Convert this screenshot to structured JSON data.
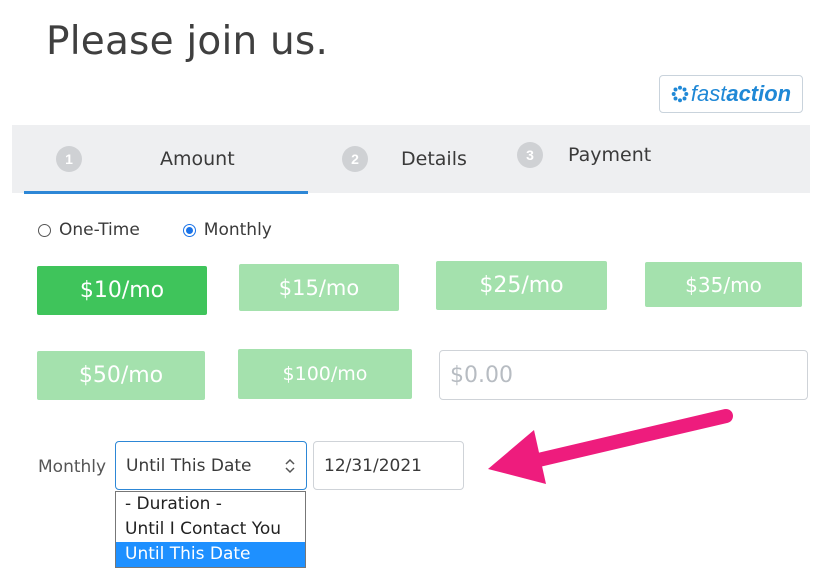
{
  "page": {
    "title": "Please join us."
  },
  "fastaction": {
    "fast": "fast",
    "action": "action",
    "brand_color": "#1f88d6"
  },
  "steps": [
    {
      "number": "1",
      "label": "Amount",
      "active": true
    },
    {
      "number": "2",
      "label": "Details",
      "active": false
    },
    {
      "number": "3",
      "label": "Payment",
      "active": false
    }
  ],
  "frequency": {
    "options": [
      {
        "label": "One-Time",
        "checked": false
      },
      {
        "label": "Monthly",
        "checked": true
      }
    ]
  },
  "amounts": [
    {
      "label": "$10/mo",
      "selected": true
    },
    {
      "label": "$15/mo",
      "selected": false
    },
    {
      "label": "$25/mo",
      "selected": false
    },
    {
      "label": "$35/mo",
      "selected": false
    },
    {
      "label": "$50/mo",
      "selected": false
    },
    {
      "label": "$100/mo",
      "selected": false
    }
  ],
  "custom_amount": {
    "placeholder": "$0.00",
    "value": ""
  },
  "duration": {
    "label": "Monthly",
    "selected": "Until This Date",
    "options": [
      "- Duration -",
      "Until I Contact You",
      "Until This Date"
    ],
    "date_value": "12/31/2021"
  },
  "colors": {
    "accent": "#2d87d6",
    "selected_amount": "#3fc45b",
    "amount_button": "#a4e1ad",
    "arrow": "#ee1c7d",
    "dropdown_highlight": "#1e90ff"
  },
  "icons": [
    "fastaction-gear-icon",
    "select-updown-icon",
    "callout-arrow-icon"
  ]
}
